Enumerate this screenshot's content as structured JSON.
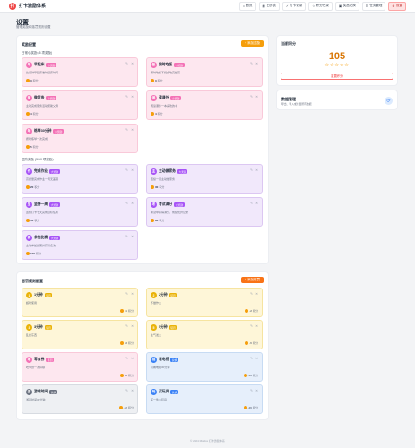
{
  "header": {
    "logo_glyph": "打",
    "brand": "打卡激励体系",
    "nav": [
      {
        "icon": "home-icon",
        "glyph": "⌂",
        "label": "首页",
        "active": false
      },
      {
        "icon": "calendar-icon",
        "glyph": "▦",
        "label": "日历表",
        "active": false
      },
      {
        "icon": "check-icon",
        "glyph": "✓",
        "label": "打卡记录",
        "active": false
      },
      {
        "icon": "star-icon",
        "glyph": "☆",
        "label": "积分记录",
        "active": false
      },
      {
        "icon": "gift-icon",
        "glyph": "▣",
        "label": "奖品兑换",
        "active": false
      },
      {
        "icon": "list-icon",
        "glyph": "☰",
        "label": "任务管理",
        "active": false
      },
      {
        "icon": "gear-icon",
        "glyph": "⚙",
        "label": "设置",
        "active": true
      }
    ]
  },
  "page": {
    "title": "设置",
    "subtitle": "管理奖励和惩罚规则设置"
  },
  "reward_panel": {
    "title": "奖励配置",
    "add_label": "+ 添加奖励",
    "groups": [
      {
        "label": "日常小奖励 (5 项奖励)"
      },
      {
        "label": "进阶奖励 (5/10 项奖励)"
      }
    ],
    "items": [
      {
        "name": "早起床",
        "tag": "小奖励",
        "desc": "比闹钟早起床准时起床时间",
        "points": "3",
        "unit": "积分",
        "avatar": "早"
      },
      {
        "name": "按时吃饭",
        "tag": "小奖励",
        "desc": "按时吃饭不挑食吃完饭菜",
        "points": "3",
        "unit": "积分",
        "avatar": "饭"
      },
      {
        "name": "做家务",
        "tag": "小奖励",
        "desc": "主动完成家务活动帮助父母",
        "points": "4",
        "unit": "积分",
        "avatar": "家"
      },
      {
        "name": "读课外",
        "tag": "小奖励",
        "desc": "阅读课外一本喜欢的书",
        "points": "4",
        "unit": "积分",
        "avatar": "读"
      },
      {
        "name": "练琴30分钟",
        "tag": "小奖励",
        "desc": "按时练琴一次完成",
        "points": "5",
        "unit": "积分",
        "avatar": "琴"
      },
      {
        "name": "完成作业",
        "tag": "大奖励",
        "desc": "高质量完成作业一周无差错",
        "points": "20",
        "unit": "积分",
        "avatar": "作"
      },
      {
        "name": "主动做家务",
        "tag": "大奖励",
        "desc": "连续一周主动做家务",
        "points": "30",
        "unit": "积分",
        "avatar": "主"
      },
      {
        "name": "坚持一周",
        "tag": "大奖励",
        "desc": "连续打卡七天完成目标任务",
        "points": "50",
        "unit": "积分",
        "avatar": "坚"
      },
      {
        "name": "考试满分",
        "tag": "大奖励",
        "desc": "考试中获得满分，成绩优异记录",
        "points": "80",
        "unit": "积分",
        "avatar": "考"
      },
      {
        "name": "参加比赛",
        "tag": "大奖励",
        "desc": "主动参加比赛并获得名次",
        "points": "100",
        "unit": "积分",
        "avatar": "赛"
      }
    ]
  },
  "penalty_panel": {
    "title": "惩罚规则配置",
    "add_label": "+ 添加惩罚",
    "items": [
      {
        "name": "1分钟",
        "tag": "惩罚",
        "desc": "超时使用",
        "points": "-1",
        "unit": "积分",
        "avatar": "1"
      },
      {
        "name": "2分钟",
        "tag": "惩罚",
        "desc": "不做作业",
        "points": "-2",
        "unit": "积分",
        "avatar": "2"
      },
      {
        "name": "3分钟",
        "tag": "惩罚",
        "desc": "乱扔东西",
        "points": "-3",
        "unit": "积分",
        "avatar": "3"
      },
      {
        "name": "5分钟",
        "tag": "惩罚",
        "desc": "生气发火",
        "points": "-5",
        "unit": "积分",
        "avatar": "5"
      },
      {
        "name": "零食券",
        "tag": "惩罚",
        "desc": "吃零食一次扣除",
        "points": "-8",
        "unit": "积分",
        "avatar": "零"
      },
      {
        "name": "看电视",
        "tag": "兑换",
        "desc": "可看电视30分钟",
        "points": "-10",
        "unit": "积分",
        "avatar": "视"
      },
      {
        "name": "游戏时间",
        "tag": "兑换",
        "desc": "游戏时间30分钟",
        "points": "-12",
        "unit": "积分",
        "avatar": "游"
      },
      {
        "name": "买玩具",
        "tag": "兑换",
        "desc": "买一件小玩具",
        "points": "-20",
        "unit": "积分",
        "avatar": "玩"
      }
    ]
  },
  "score": {
    "title": "当前积分",
    "value": "105",
    "stars": "☆☆☆☆☆",
    "button": "重置积分"
  },
  "data_manage": {
    "title": "数据管理",
    "subtitle": "导出、导入或重置所有数据",
    "icon": "database-icon",
    "glyph": "⟳"
  },
  "footer": "© 2024 Mstdsx 打卡激励体系",
  "icons": {
    "edit": "✎",
    "delete": "✕"
  },
  "colors": {
    "accent": "#ef4444",
    "reward_btn": "#f59e0b",
    "penalty_btn": "#f97316"
  }
}
